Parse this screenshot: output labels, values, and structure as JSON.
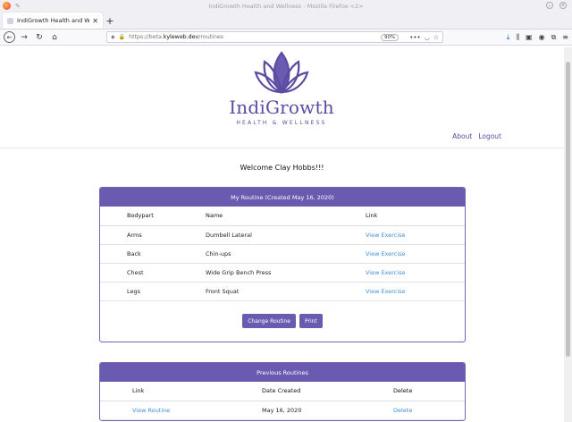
{
  "window": {
    "title": "IndiGrowth Health and Wellness - Mozilla Firefox <2>"
  },
  "tab": {
    "title": "IndiGrowth Health and We"
  },
  "urlbar": {
    "prefix": "https://beta.",
    "host": "kyleweb.dev",
    "path": "/routines",
    "zoom": "90%"
  },
  "brand": {
    "name": "IndiGrowth",
    "tagline": "HEALTH & WELLNESS"
  },
  "nav": {
    "about": "About",
    "logout": "Logout"
  },
  "welcome": "Welcome Clay Hobbs!!!",
  "routine": {
    "title": "My Routine (Created May 16, 2020)",
    "headers": [
      "Bodypart",
      "Name",
      "Link"
    ],
    "rows": [
      {
        "bodypart": "Arms",
        "name": "Dumbell Lateral",
        "link": "View Exercise"
      },
      {
        "bodypart": "Back",
        "name": "Chin-ups",
        "link": "View Exercise"
      },
      {
        "bodypart": "Chest",
        "name": "Wide Grip Bench Press",
        "link": "View Exercise"
      },
      {
        "bodypart": "Legs",
        "name": "Front Squat",
        "link": "View Exercise"
      }
    ],
    "change_button": "Change Routine",
    "print_button": "Print"
  },
  "previous": {
    "title": "Previous Routines",
    "headers": [
      "Link",
      "Date Created",
      "Delete"
    ],
    "rows": [
      {
        "link": "View Routine",
        "date": "May 16, 2020",
        "delete": "Delete"
      }
    ]
  },
  "colors": {
    "brand": "#5d4aa2",
    "card_header": "#6b5bb0",
    "link": "#3f8fd8"
  }
}
